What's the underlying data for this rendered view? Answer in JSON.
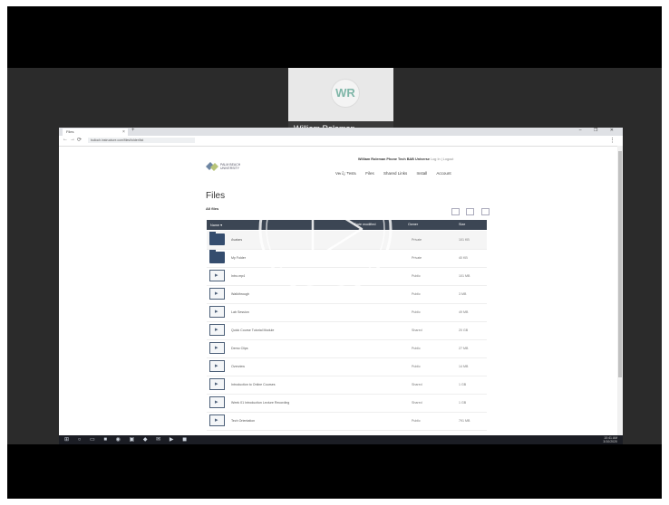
{
  "meeting": {
    "participant_initials": "WR",
    "participant_name": "William Roleman"
  },
  "browser": {
    "tab_title": "Files",
    "tab_close": "×",
    "new_tab": "+",
    "window_controls": "– ❐ ✕",
    "url": "bulloch.instructure.com/files/folder/list",
    "nav_back": "←",
    "nav_forward": "→",
    "nav_reload": "⟳",
    "profile": "⋮"
  },
  "site": {
    "logo_text": "PALM BEACH UNIVERSITY",
    "user_line": "William Roleman Phone Tech BAB Universe",
    "user_extra": "Log In | Logout",
    "nav": [
      "Verify Tests",
      "Files",
      "Shared Links",
      "Install",
      "Account"
    ]
  },
  "files": {
    "title": "Files",
    "subtitle": "All files",
    "columns": {
      "name": "Name ▾",
      "modified": "Date modified",
      "owner": "Owner",
      "size": "Size"
    },
    "rows": [
      {
        "type": "folder",
        "name": "Avatars",
        "owner": "Private",
        "size": "101 KB"
      },
      {
        "type": "folder",
        "name": "My Folder",
        "owner": "Private",
        "size": "40 KB"
      },
      {
        "type": "file",
        "name": "Intro.mp4",
        "owner": "Public",
        "size": "101 MB"
      },
      {
        "type": "file",
        "name": "Walkthrough",
        "owner": "Public",
        "size": "3 MB"
      },
      {
        "type": "file",
        "name": "Lab Session",
        "owner": "Public",
        "size": "49 MB"
      },
      {
        "type": "file",
        "name": "Quick Course Tutorial Module",
        "owner": "Shared",
        "size": "20 GB"
      },
      {
        "type": "file",
        "name": "Demo Clips",
        "owner": "Public",
        "size": "27 MB"
      },
      {
        "type": "file",
        "name": "Overview",
        "owner": "Public",
        "size": "14 MB"
      },
      {
        "type": "file",
        "name": "Introduction to Online Courses",
        "owner": "Shared",
        "size": "1 GB"
      },
      {
        "type": "file",
        "name": "Week 01 Introduction Lecture Recording",
        "owner": "Shared",
        "size": "1 GB"
      },
      {
        "type": "file",
        "name": "Tech Orientation",
        "owner": "Public",
        "size": "791 MB"
      }
    ]
  },
  "taskbar": {
    "icons": "⊞ ○ ▭ ■ ◉ ▣ ◆ ✉ ▶ ◼",
    "time": "10:41 AM",
    "date": "3/10/2020"
  },
  "player": {
    "play_icon": "play-icon"
  }
}
